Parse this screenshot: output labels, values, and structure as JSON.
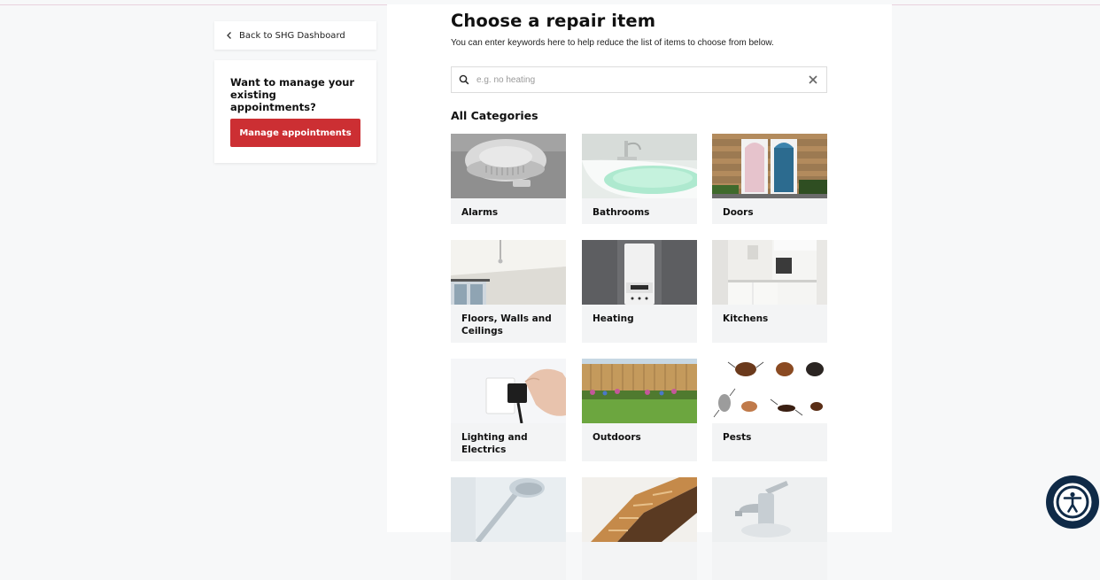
{
  "sidebar": {
    "back_label": "Back to SHG Dashboard",
    "manage_question": "Want to manage your existing appointments?",
    "manage_button": "Manage appointments"
  },
  "main": {
    "title": "Choose a repair item",
    "subtitle": "You can enter keywords here to help reduce the list of items to choose from below.",
    "search_placeholder": "e.g. no heating",
    "search_value": "",
    "categories_heading": "All Categories",
    "categories": [
      {
        "label": "Alarms",
        "image": "smoke-alarm"
      },
      {
        "label": "Bathrooms",
        "image": "bathtub"
      },
      {
        "label": "Doors",
        "image": "front-doors"
      },
      {
        "label": "Floors, Walls and Ceilings",
        "image": "empty-room"
      },
      {
        "label": "Heating",
        "image": "boiler"
      },
      {
        "label": "Kitchens",
        "image": "kitchen"
      },
      {
        "label": "Lighting and Electrics",
        "image": "plug-socket"
      },
      {
        "label": "Outdoors",
        "image": "garden-fence"
      },
      {
        "label": "Pests",
        "image": "insects"
      },
      {
        "label": "",
        "image": "shower-head"
      },
      {
        "label": "",
        "image": "staircase"
      },
      {
        "label": "",
        "image": "tap"
      }
    ]
  },
  "icons": {
    "back": "chevron-left-icon",
    "search": "search-icon",
    "clear": "close-icon",
    "accessibility": "accessibility-icon"
  },
  "colors": {
    "accent": "#cc2f33",
    "accessibility_bg": "#0f2a47",
    "tile_bg": "#f3f4f5"
  }
}
